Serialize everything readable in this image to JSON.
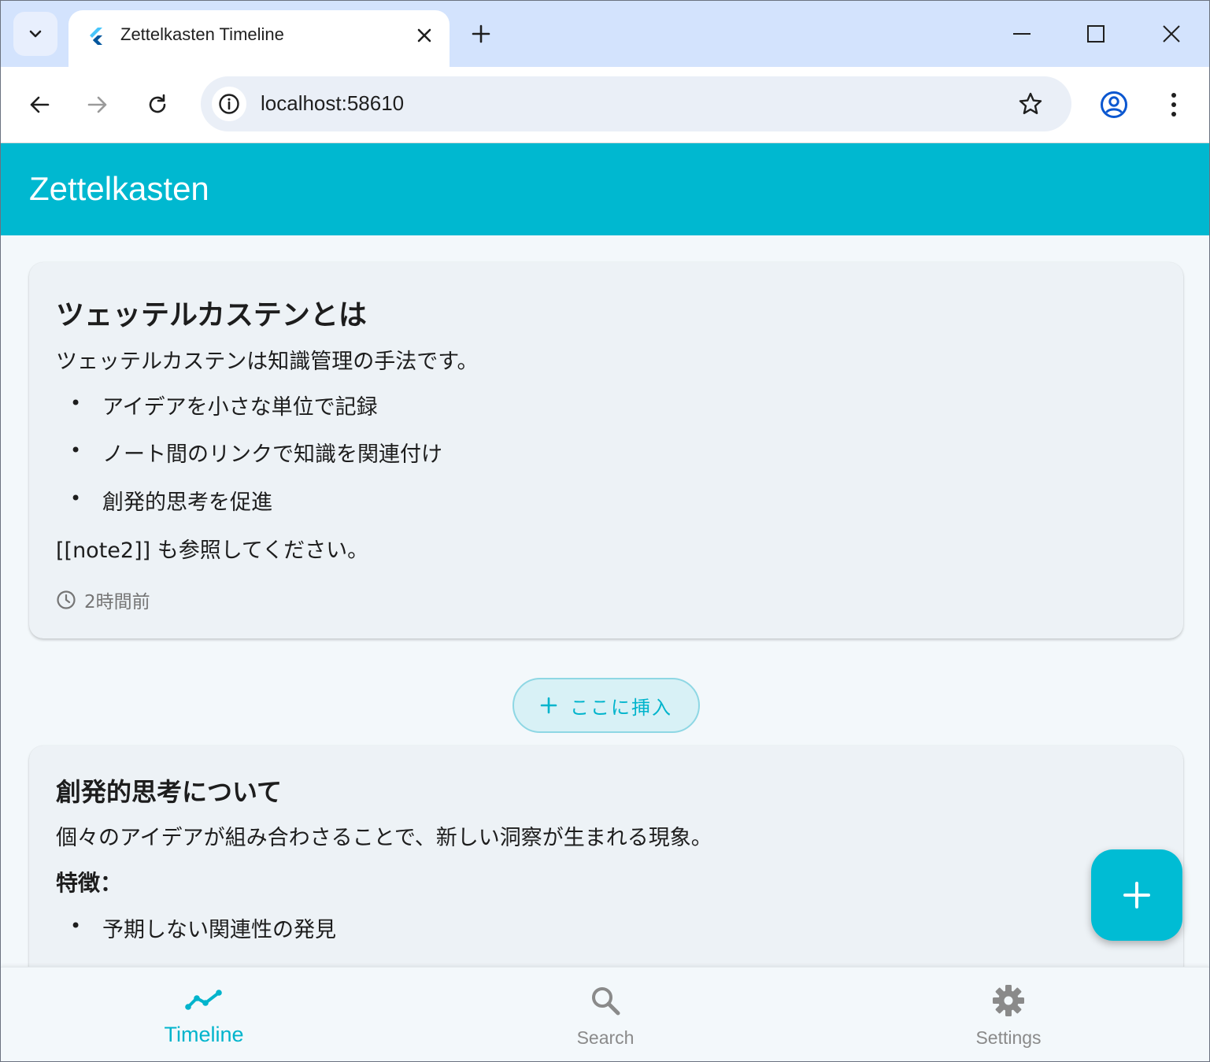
{
  "browser": {
    "tab_title": "Zettelkasten Timeline",
    "url": "localhost:58610"
  },
  "app": {
    "title": "Zettelkasten",
    "accent_color": "#00b8d0"
  },
  "notes": [
    {
      "title": "ツェッテルカステンとは",
      "intro": "ツェッテルカステンは知識管理の手法です。",
      "bullets": [
        "アイデアを小さな単位で記録",
        "ノート間のリンクで知識を関連付け",
        "創発的思考を促進"
      ],
      "footer_text": "[[note2]] も参照してください。",
      "timestamp": "2時間前"
    },
    {
      "title": "創発的思考について",
      "intro": "個々のアイデアが組み合わさることで、新しい洞察が生まれる現象。",
      "subheading": "特徴：",
      "bullets": [
        "予期しない関連性の発見"
      ]
    }
  ],
  "insert_button": {
    "label": "ここに挿入",
    "icon": "plus-icon"
  },
  "fab": {
    "icon": "plus-icon"
  },
  "bottom_nav": [
    {
      "label": "Timeline",
      "icon": "timeline-icon",
      "active": true
    },
    {
      "label": "Search",
      "icon": "search-icon",
      "active": false
    },
    {
      "label": "Settings",
      "icon": "gear-icon",
      "active": false
    }
  ]
}
